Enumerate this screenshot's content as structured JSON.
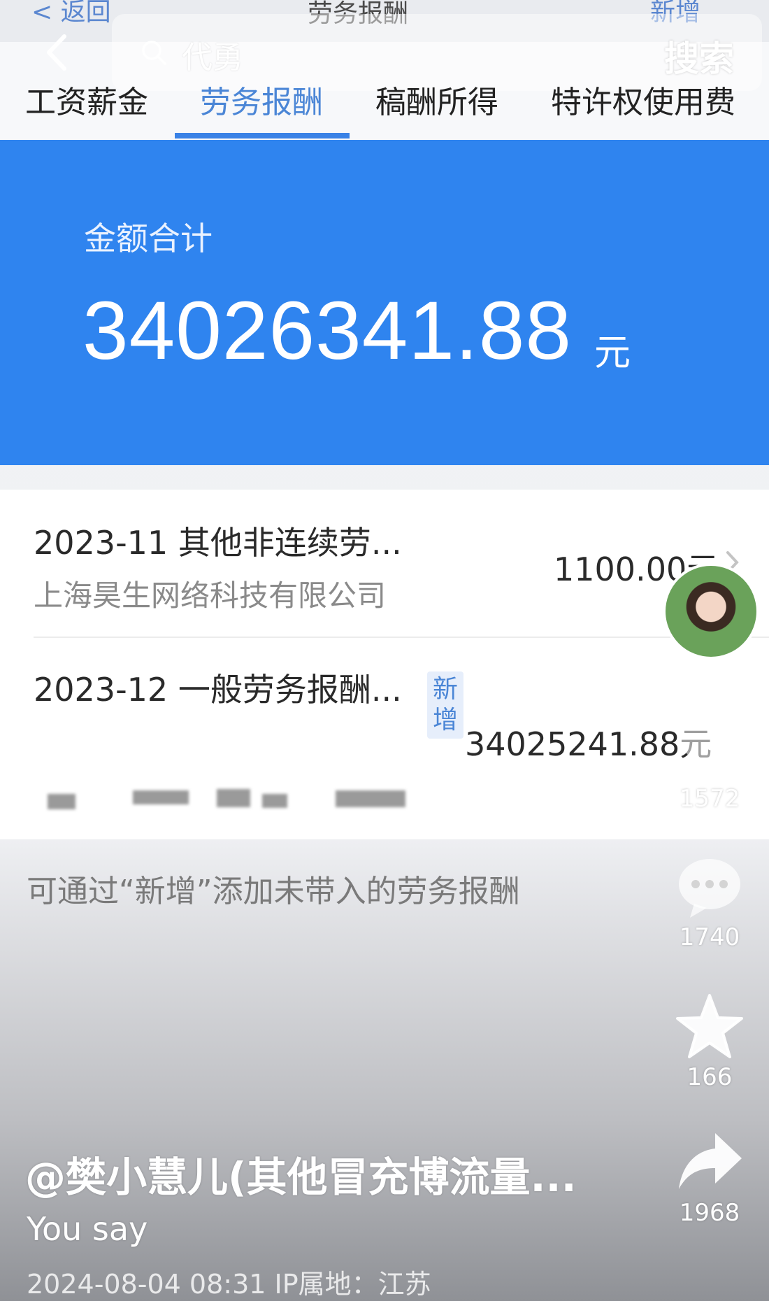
{
  "nav": {
    "back_label": "< 返回",
    "title": "劳务报酬",
    "add_label": "新增"
  },
  "search": {
    "query": "代勇",
    "button_label": "搜索"
  },
  "tabs": [
    {
      "label": "工资薪金",
      "active": false
    },
    {
      "label": "劳务报酬",
      "active": true
    },
    {
      "label": "稿酬所得",
      "active": false
    },
    {
      "label": "特许权使用费",
      "active": false
    }
  ],
  "summary": {
    "label": "金额合计",
    "amount": "34026341.88",
    "unit": "元"
  },
  "records": [
    {
      "title": "2023-11 其他非连续劳...",
      "payer": "上海昊生网络科技有限公司",
      "amount": "1100.00元"
    },
    {
      "title": "2023-12 一般劳务报酬...",
      "badge": "新增",
      "amount": "34025241.88元"
    }
  ],
  "hint": "可通过“新增”添加未带入的劳务报酬",
  "overlay": {
    "likes": "1572",
    "comments": "1740",
    "favorites": "166",
    "shares": "1968"
  },
  "post": {
    "author": "@樊小慧儿(其他冒充博流量...",
    "caption": "You say",
    "meta": "2024-08-04 08:31  IP属地：江苏"
  },
  "colors": {
    "accent_blue": "#2f84ef",
    "tab_active": "#4b86d6"
  }
}
